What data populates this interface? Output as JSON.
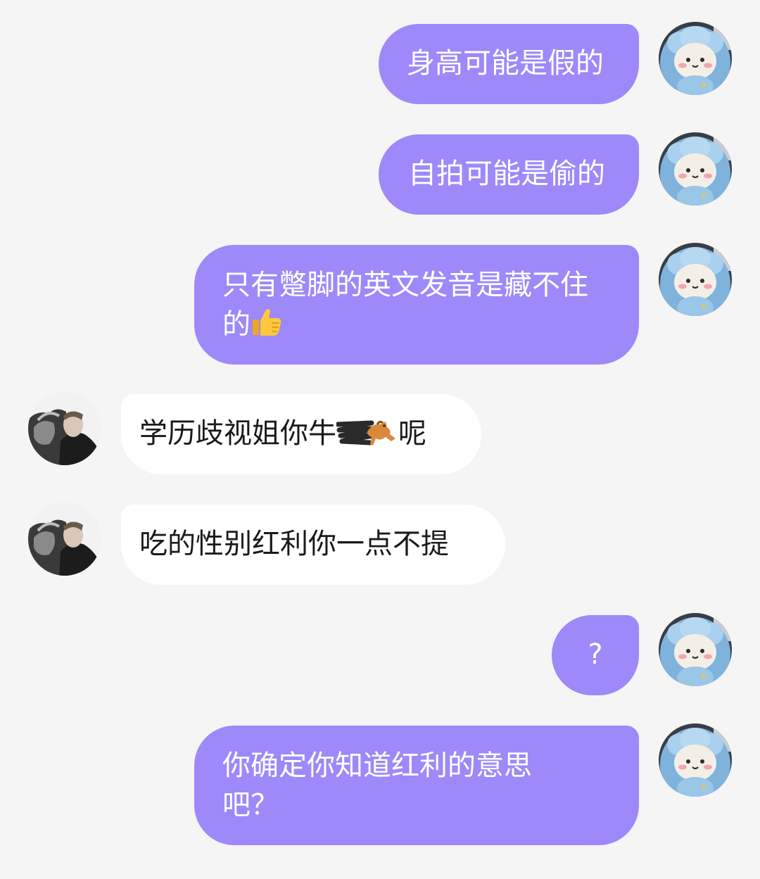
{
  "messages": [
    {
      "direction": "outgoing",
      "text": "身高可能是假的"
    },
    {
      "direction": "outgoing",
      "text": "自拍可能是偷的"
    },
    {
      "direction": "outgoing",
      "text": "只有蹩脚的英文发音是藏不住的",
      "emoji": "thumbs-up"
    },
    {
      "direction": "incoming",
      "text_before": "学历歧视姐你牛",
      "text_after": "呢",
      "obscured": "scribble-with-horse-emoji"
    },
    {
      "direction": "incoming",
      "text": "吃的性别红利你一点不提"
    },
    {
      "direction": "outgoing",
      "text": "?"
    },
    {
      "direction": "outgoing",
      "text": "你确定你知道红利的意思吧？"
    }
  ],
  "colors": {
    "background": "#f5f5f5",
    "outgoing_bubble": "#9d89f9",
    "incoming_bubble": "#ffffff",
    "outgoing_text": "#ffffff",
    "incoming_text": "#1a1a1a"
  },
  "avatars": {
    "self": "plush-sheep-avatar",
    "other": "monochrome-photo-avatar"
  }
}
